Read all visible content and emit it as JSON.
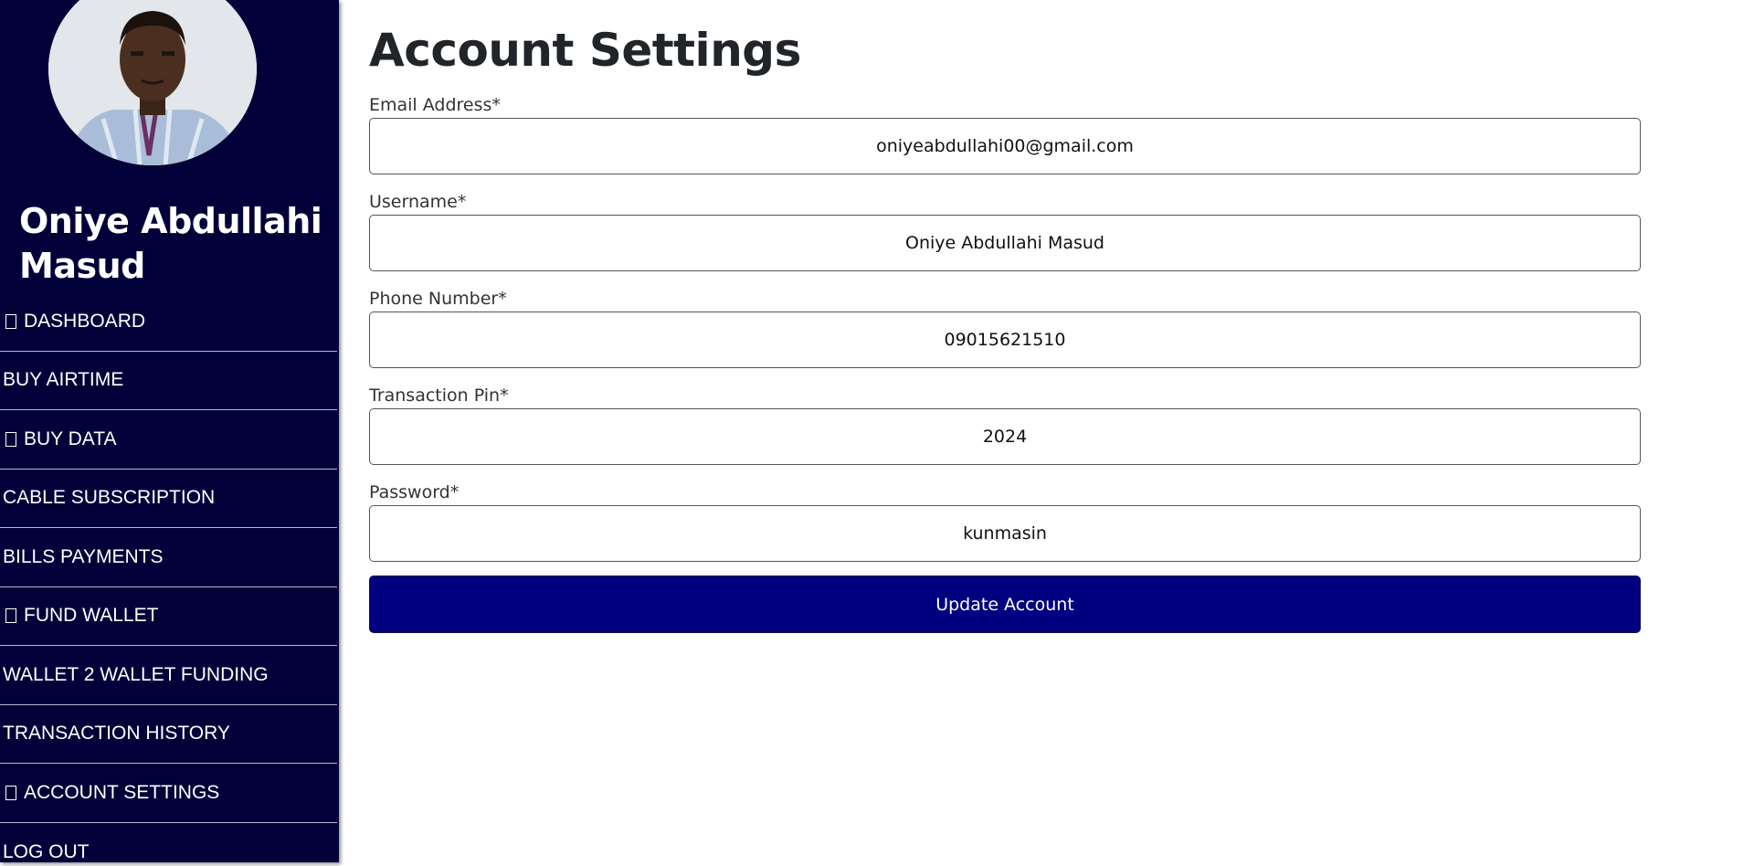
{
  "user": {
    "name": "Oniye Abdullahi Masud",
    "avatar": "profile-photo"
  },
  "sidebar": {
    "items": [
      {
        "label": "DASHBOARD",
        "icon": "placeholder-glyph"
      },
      {
        "label": "BUY AIRTIME"
      },
      {
        "label": "BUY DATA",
        "icon": "placeholder-glyph"
      },
      {
        "label": "CABLE SUBSCRIPTION"
      },
      {
        "label": "BILLS PAYMENTS"
      },
      {
        "label": "FUND WALLET",
        "icon": "placeholder-glyph"
      },
      {
        "label": "WALLET 2 WALLET FUNDING"
      },
      {
        "label": "TRANSACTION HISTORY"
      },
      {
        "label": "ACCOUNT SETTINGS",
        "icon": "placeholder-glyph"
      },
      {
        "label": "LOG OUT"
      }
    ]
  },
  "main": {
    "title": "Account Settings",
    "form": {
      "email": {
        "label": "Email Address*",
        "value": "oniyeabdullahi00@gmail.com"
      },
      "username": {
        "label": "Username*",
        "value": "Oniye Abdullahi Masud"
      },
      "phone": {
        "label": "Phone Number*",
        "value": "09015621510"
      },
      "pin": {
        "label": "Transaction Pin*",
        "value": "2024"
      },
      "password": {
        "label": "Password*",
        "value": "kunmasin"
      },
      "submit_label": "Update Account"
    }
  },
  "colors": {
    "sidebar_bg": "#020039",
    "button_bg": "#000080",
    "text": "#212529"
  }
}
